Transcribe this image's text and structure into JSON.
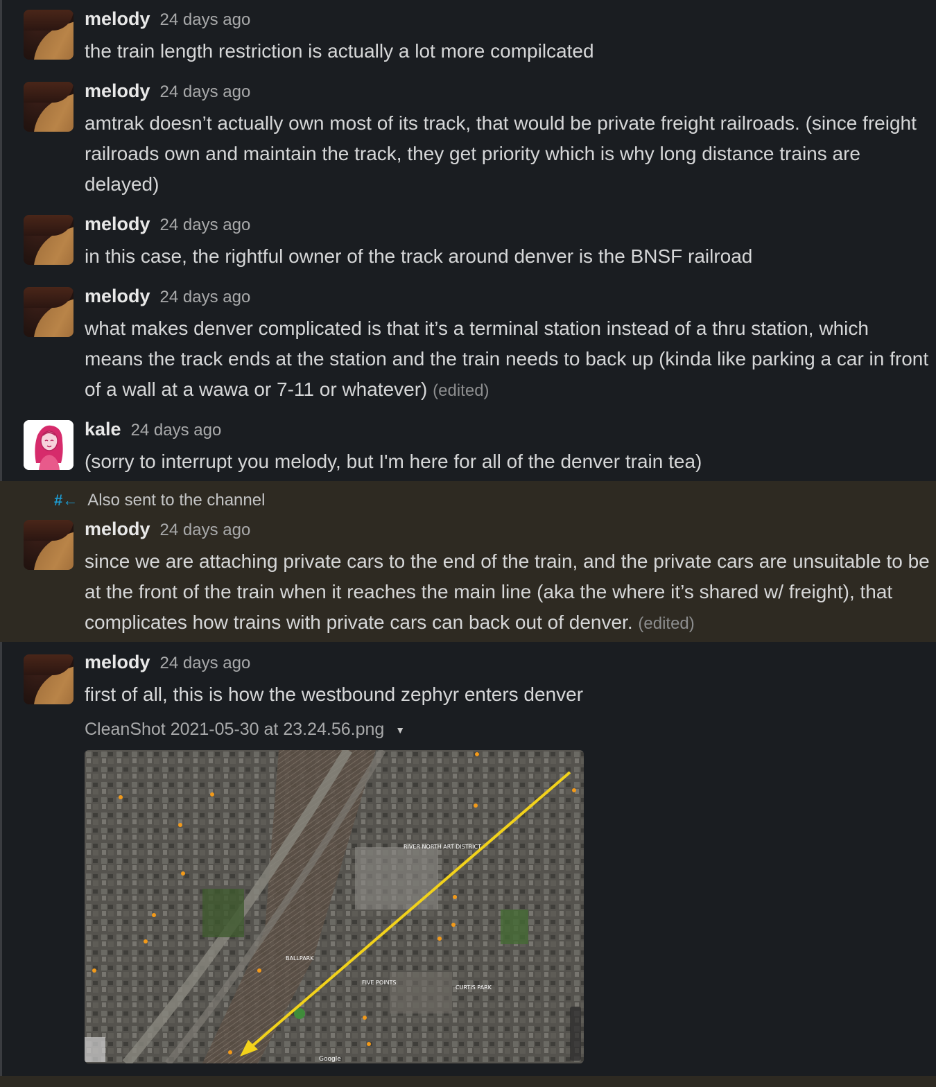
{
  "channel_note": "Also sent to the channel",
  "messages": [
    {
      "author": "melody",
      "time": "24 days ago",
      "text": "the train length restriction is actually a lot more compilcated",
      "edited": ""
    },
    {
      "author": "melody",
      "time": "24 days ago",
      "text": "amtrak doesn’t actually own most of its track, that would be private freight railroads. (since freight railroads own and maintain the track, they get priority which is why long distance trains are delayed)",
      "edited": ""
    },
    {
      "author": "melody",
      "time": "24 days ago",
      "text": "in this case, the rightful owner of the track around denver is the BNSF railroad",
      "edited": ""
    },
    {
      "author": "melody",
      "time": "24 days ago",
      "text": "what makes denver complicated is that it’s a terminal station instead of a thru station, which means the track ends at the station and the train needs to back up (kinda like parking a car in front of a wall at a wawa or 7-11 or whatever)",
      "edited": "(edited)"
    },
    {
      "author": "kale",
      "time": "24 days ago",
      "text": "(sorry to interrupt you melody, but I'm here for all of the denver train tea)",
      "edited": ""
    },
    {
      "author": "melody",
      "time": "24 days ago",
      "text": "since we are attaching private cars to the end of the train, and the private cars are unsuitable to be at the front of the train when it reaches the main line (aka the where it’s shared w/ freight), that complicates how trains with private cars can back out of denver.",
      "edited": "(edited)"
    },
    {
      "author": "melody",
      "time": "24 days ago",
      "text": "first of all, this is how the westbound zephyr enters denver",
      "edited": ""
    }
  ],
  "attachment": {
    "filename": "CleanShot 2021-05-30 at 23.24.56.png",
    "map_labels": {
      "river_north": "RIVER NORTH ART DISTRICT",
      "ballpark": "BALLPARK",
      "five_points": "FIVE POINTS",
      "curtis_park": "CURTIS PARK",
      "google": "Google"
    }
  },
  "colors": {
    "background": "#1a1d21",
    "highlight": "#2e2a22",
    "link_icon": "#1d9bd1",
    "arrow": "#f2d21b"
  },
  "icons": [
    "also-sent-icon",
    "dropdown-caret-icon"
  ]
}
